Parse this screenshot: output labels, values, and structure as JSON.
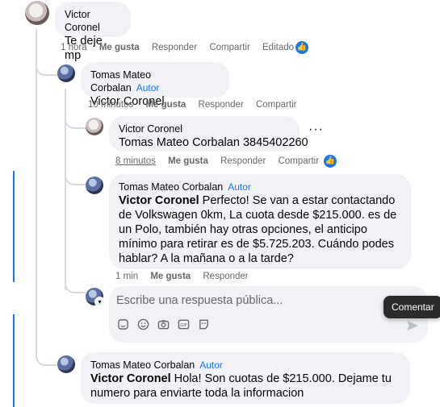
{
  "comment_1": {
    "author": "Victor Coronel",
    "text": "Te deje mp",
    "actions": {
      "time": "1 hora",
      "like": "Me gusta",
      "reply": "Responder",
      "share": "Compartir",
      "edited": "Editado"
    },
    "reaction_icon": "like-icon"
  },
  "reply_1": {
    "author": "Tomas Mateo Corbalan",
    "badge": "Autor",
    "mention": "Victor Coronel",
    "text": "",
    "actions": {
      "time": "10 minutos",
      "like": "Me gusta",
      "reply": "Responder",
      "share": "Compartir"
    }
  },
  "reply_2": {
    "author": "Victor Coronel",
    "mention": "Tomas Mateo Corbalan",
    "text": " 3845402260",
    "more": "···",
    "actions": {
      "time": "8 minutos",
      "like": "Me gusta",
      "reply": "Responder",
      "share": "Compartir"
    },
    "reaction_icon": "like-icon"
  },
  "reply_3": {
    "author": "Tomas Mateo Corbalan",
    "badge": "Autor",
    "mention": "Victor Coronel",
    "text": " Perfecto! Se van a estar contactando de Volkswagen 0km, La cuota desde $215.000. es de un Polo, también hay otras opciones, el anticipo mínimo para retirar es de $5.725.203. Cuándo podes hablar? A la mañana o a la tarde?",
    "actions": {
      "time": "1 min",
      "like": "Me gusta",
      "reply": "Responder"
    }
  },
  "reply_box": {
    "placeholder": "Escribe una respuesta pública...",
    "tools": [
      "sticker-icon",
      "emoji-icon",
      "camera-icon",
      "gif-icon",
      "avatar-sticker-icon"
    ],
    "tooltip": "Comentar"
  },
  "reply_4": {
    "author": "Tomas Mateo Corbalan",
    "badge": "Autor",
    "mention": "Victor Coronel",
    "text": " Hola! Son cuotas de $215.000. Dejame tu numero para enviarte toda la informacion"
  },
  "colors": {
    "accent": "#1877f2",
    "bubble": "#f0f2f5",
    "muted": "#65676b"
  }
}
